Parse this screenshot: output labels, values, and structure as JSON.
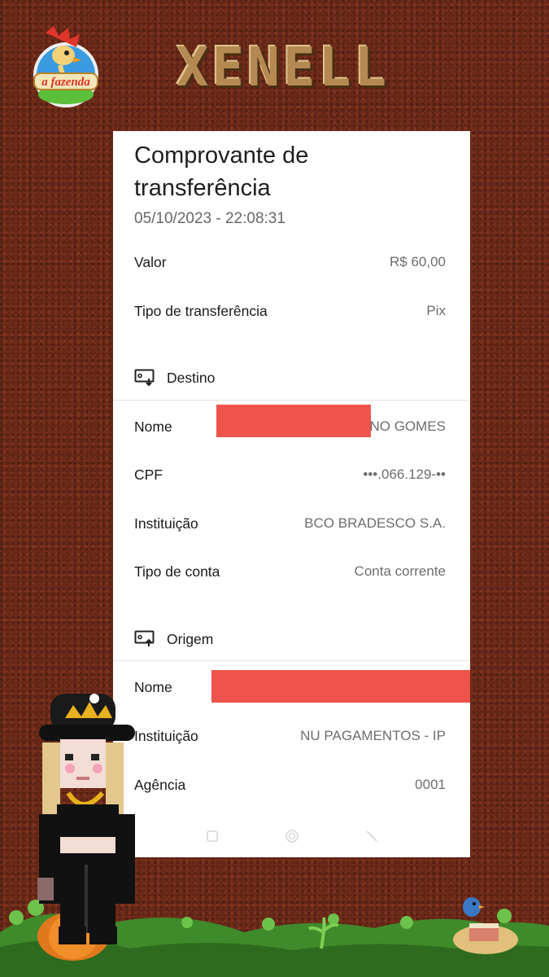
{
  "frame": {
    "title": "XENELL",
    "logo_text": "a fazenda"
  },
  "receipt": {
    "title_line1": "Comprovante de",
    "title_line2": "transferência",
    "datetime": "05/10/2023 - 22:08:31",
    "summary": [
      {
        "label": "Valor",
        "value": "R$ 60,00"
      },
      {
        "label": "Tipo de transferência",
        "value": "Pix"
      }
    ],
    "destino": {
      "heading": "Destino",
      "icon": "screen-down-icon",
      "rows": [
        {
          "label": "Nome",
          "value": "NO GOMES"
        },
        {
          "label": "CPF",
          "value": "•••.066.129-••"
        },
        {
          "label": "Instituição",
          "value": "BCO BRADESCO S.A."
        },
        {
          "label": "Tipo de conta",
          "value": "Conta corrente"
        }
      ]
    },
    "origem": {
      "heading": "Origem",
      "icon": "screen-up-icon",
      "rows": [
        {
          "label": "Nome",
          "value": ""
        },
        {
          "label": "Instituição",
          "value": "NU PAGAMENTOS - IP"
        },
        {
          "label": "Agência",
          "value": "0001"
        }
      ]
    }
  },
  "colors": {
    "background": "#6e2a1a",
    "redaction": "#ee544b",
    "card": "#ffffff"
  }
}
